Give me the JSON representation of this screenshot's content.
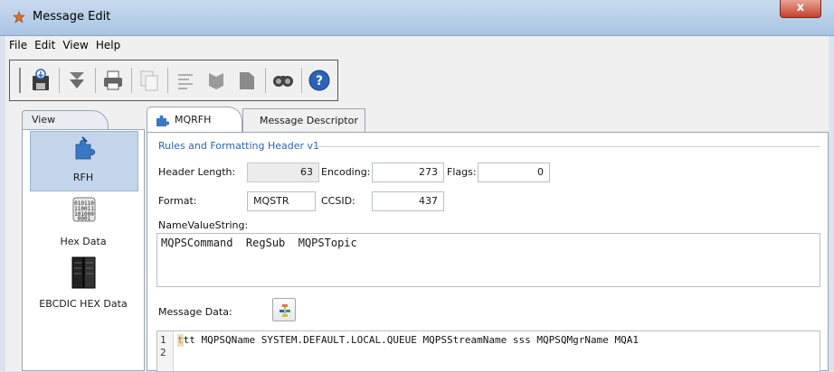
{
  "window": {
    "title": "Message Edit",
    "close_glyph": "x"
  },
  "menu": [
    "File",
    "Edit",
    "View",
    "Help"
  ],
  "toolbar": {
    "icons": [
      "save-icon",
      "import-icon",
      "print-icon",
      "copy-icon",
      "format-icon",
      "export-icon",
      "export-alt-icon",
      "find-icon",
      "help-icon"
    ]
  },
  "left_panel": {
    "tab": "View",
    "items": [
      {
        "label": "RFH",
        "icon": "rfh-puzzle-icon",
        "selected": true
      },
      {
        "label": "Hex Data",
        "icon": "hex-data-icon",
        "selected": false
      },
      {
        "label": "EBCDIC HEX Data",
        "icon": "ebcdic-server-icon",
        "selected": false
      }
    ]
  },
  "tabs": [
    {
      "label": "MQRFH",
      "active": true
    },
    {
      "label": "Message Descriptor",
      "active": false
    }
  ],
  "rfh": {
    "group_title": "Rules and Formatting Header v1",
    "header_length_label": "Header Length:",
    "header_length": "63",
    "encoding_label": "Encoding:",
    "encoding": "273",
    "flags_label": "Flags:",
    "flags": "0",
    "format_label": "Format:",
    "format": "MQSTR",
    "ccsid_label": "CCSID:",
    "ccsid": "437",
    "nvs_label": "NameValueString:",
    "nvs": "MQPSCommand  RegSub  MQPSTopic",
    "message_data_label": "Message Data:",
    "message_lines": [
      {
        "num": "1",
        "text": "ttt MQPSQName SYSTEM.DEFAULT.LOCAL.QUEUE MQPSStreamName sss MQPSQMgrName MQA1"
      },
      {
        "num": "2",
        "text": ""
      }
    ]
  },
  "colors": {
    "accent": "#2a63b8",
    "selection": "#c3d5ea",
    "titlebar": "#b9d1ea",
    "close": "#c94a33"
  }
}
